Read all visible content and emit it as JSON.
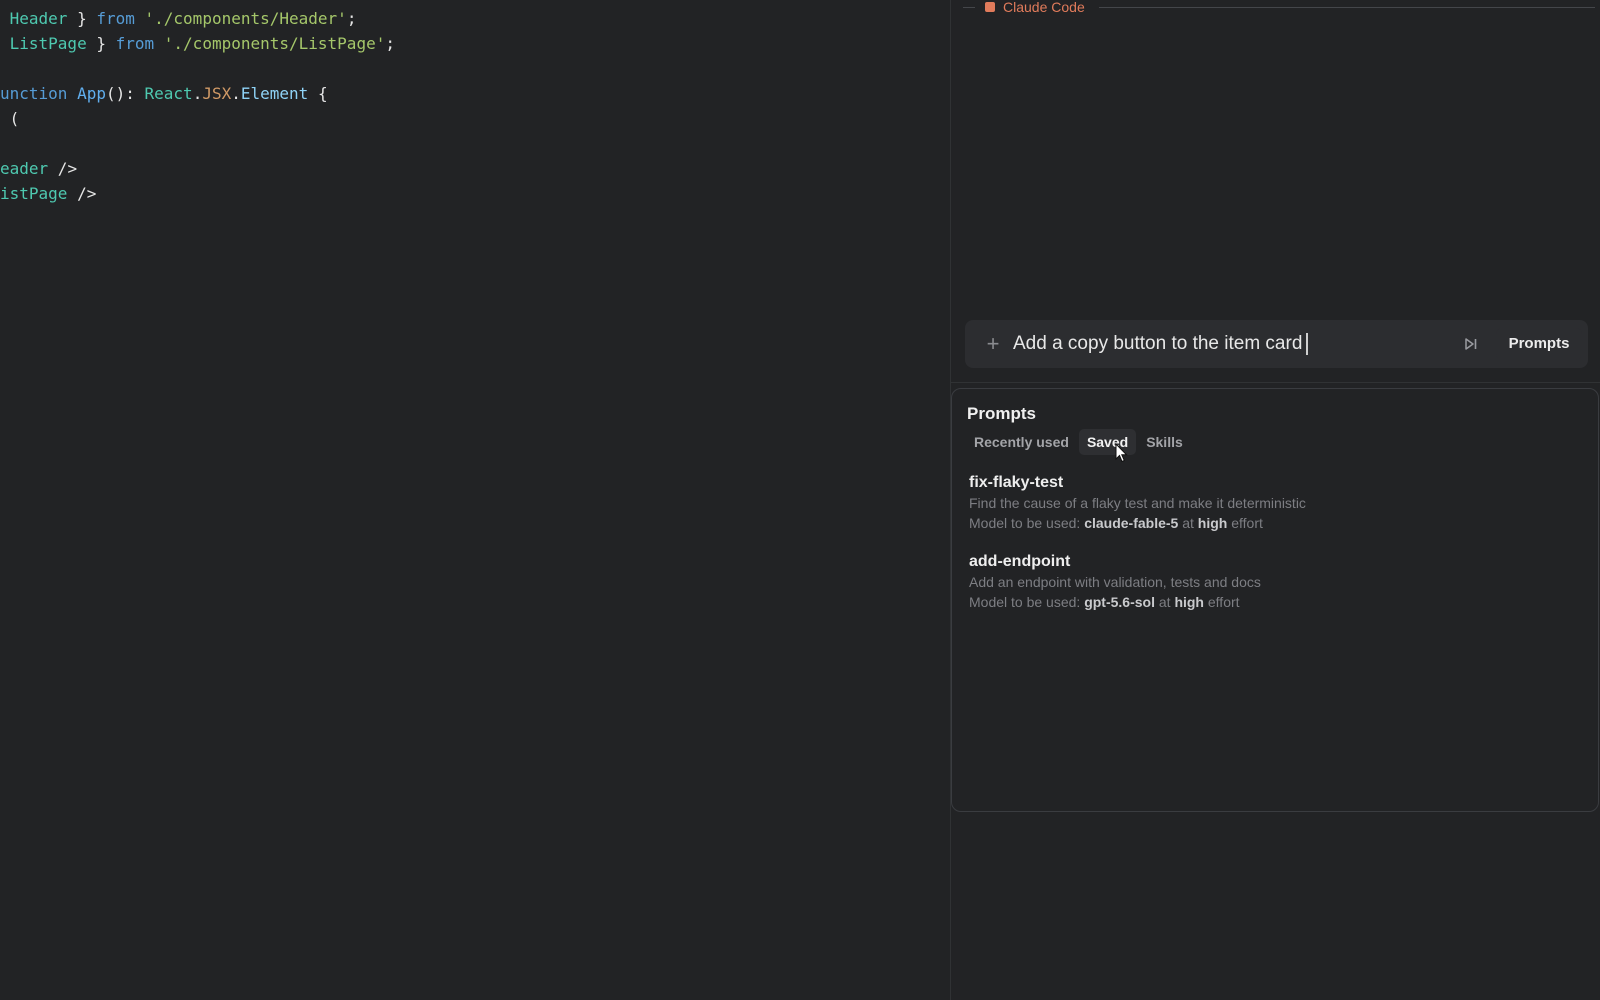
{
  "editor": {
    "lines": [
      [
        {
          "t": " Header",
          "c": "#4ec9b0"
        },
        {
          "t": " } ",
          "c": "#e6e6e6"
        },
        {
          "t": "from",
          "c": "#569cd6"
        },
        {
          "t": " ",
          "c": "#e6e6e6"
        },
        {
          "t": "'./components/Header'",
          "c": "#a5c76a"
        },
        {
          "t": ";",
          "c": "#e6e6e6"
        }
      ],
      [
        {
          "t": " ListPage",
          "c": "#4ec9b0"
        },
        {
          "t": " } ",
          "c": "#e6e6e6"
        },
        {
          "t": "from",
          "c": "#569cd6"
        },
        {
          "t": " ",
          "c": "#e6e6e6"
        },
        {
          "t": "'./components/ListPage'",
          "c": "#a5c76a"
        },
        {
          "t": ";",
          "c": "#e6e6e6"
        }
      ],
      [],
      [
        {
          "t": "unction",
          "c": "#569cd6"
        },
        {
          "t": " ",
          "c": "#e6e6e6"
        },
        {
          "t": "App",
          "c": "#61afef"
        },
        {
          "t": "(): ",
          "c": "#e6e6e6"
        },
        {
          "t": "React",
          "c": "#4ec9b0"
        },
        {
          "t": ".",
          "c": "#e6e6e6"
        },
        {
          "t": "JSX",
          "c": "#d19a66"
        },
        {
          "t": ".",
          "c": "#e6e6e6"
        },
        {
          "t": "Element",
          "c": "#8fd3f7"
        },
        {
          "t": " {",
          "c": "#e6e6e6"
        }
      ],
      [
        {
          "t": " (",
          "c": "#e6e6e6"
        }
      ],
      [],
      [
        {
          "t": "eader",
          "c": "#4ec9b0"
        },
        {
          "t": " />",
          "c": "#e6e6e6"
        }
      ],
      [
        {
          "t": "istPage",
          "c": "#4ec9b0"
        },
        {
          "t": " />",
          "c": "#e6e6e6"
        }
      ]
    ]
  },
  "panel": {
    "title": "Claude Code",
    "accent": "#e07b5b"
  },
  "input": {
    "text": "Add a copy button to the item card",
    "plus_icon": "plus-icon",
    "skip_icon": "skip-forward-icon",
    "prompts_label": "Prompts"
  },
  "popover": {
    "title": "Prompts",
    "tabs": [
      {
        "label": "Recently used",
        "active": false
      },
      {
        "label": "Saved",
        "active": true
      },
      {
        "label": "Skills",
        "active": false
      }
    ],
    "items": [
      {
        "name": "fix-flaky-test",
        "description": "Find the cause of a flaky test and make it deterministic",
        "model_prefix": "Model to be used:",
        "model": "claude-fable-5",
        "at": "at",
        "effort_level": "high",
        "effort_suffix": "effort"
      },
      {
        "name": "add-endpoint",
        "description": "Add an endpoint with validation, tests and docs",
        "model_prefix": "Model to be used:",
        "model": "gpt-5.6-sol",
        "at": "at",
        "effort_level": "high",
        "effort_suffix": "effort"
      }
    ]
  }
}
